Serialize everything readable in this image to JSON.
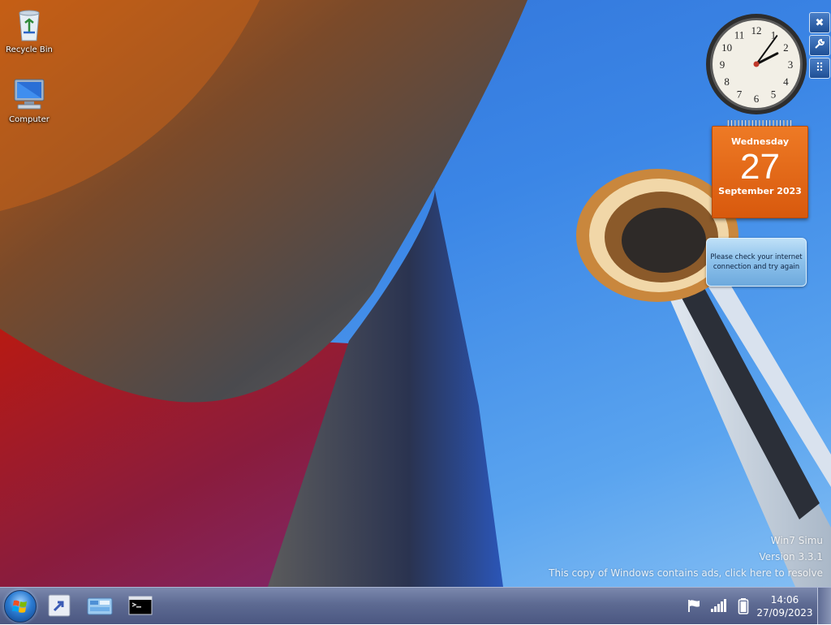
{
  "desktop": {
    "icons": [
      {
        "label": "Recycle Bin",
        "icon": "recycle-bin-icon"
      },
      {
        "label": "Computer",
        "icon": "computer-icon"
      }
    ]
  },
  "gadget_toolbar": {
    "close_glyph": "✖",
    "options_glyph": "🔧",
    "drag_glyph": "⠿"
  },
  "clock_gadget": {
    "numerals": [
      "12",
      "1",
      "2",
      "3",
      "4",
      "5",
      "6",
      "7",
      "8",
      "9",
      "10",
      "11"
    ],
    "time": "14:06"
  },
  "calendar_gadget": {
    "weekday": "Wednesday",
    "day": "27",
    "month_year": "September 2023"
  },
  "weather_gadget": {
    "message": "Please check your internet connection and try again"
  },
  "watermark": {
    "line1": "Win7 Simu",
    "line2": "Version 3.3.1",
    "line3": "This copy of Windows contains ads, click here to resolve"
  },
  "taskbar": {
    "start": "start-orb-icon",
    "pinned": [
      {
        "name": "shortcut-app-icon"
      },
      {
        "name": "control-panel-icon"
      },
      {
        "name": "command-prompt-icon"
      }
    ],
    "tray": {
      "icons": [
        "action-center-flag-icon",
        "network-signal-icon",
        "battery-icon"
      ]
    },
    "clock": {
      "time": "14:06",
      "date": "27/09/2023"
    }
  },
  "colors": {
    "calendar_orange": "#e36a17",
    "taskbar": "#5d6a92",
    "sky": "#3b86e6"
  }
}
